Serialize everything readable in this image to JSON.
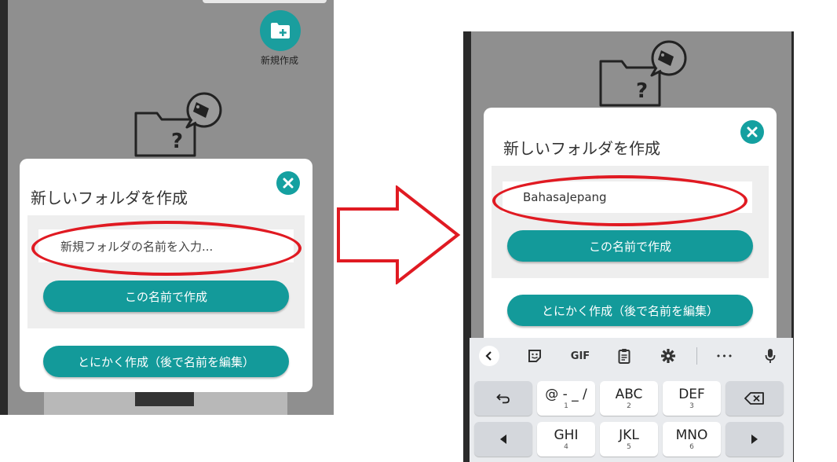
{
  "left": {
    "fab_label": "新規作成",
    "dialog": {
      "title": "新しいフォルダを作成",
      "input_placeholder": "新規フォルダの名前を入力...",
      "create_with_name": "この名前で作成",
      "create_anyway": "とにかく作成（後で名前を編集）"
    }
  },
  "right": {
    "dialog": {
      "title": "新しいフォルダを作成",
      "input_value": "BahasaJepang",
      "create_with_name": "この名前で作成",
      "create_anyway": "とにかく作成（後で名前を編集）"
    },
    "keyboard": {
      "toolbar": {
        "gif": "GIF",
        "more": "•••"
      },
      "keys": [
        {
          "main": "@ - _ /",
          "sub": "1"
        },
        {
          "main": "ABC",
          "sub": "2"
        },
        {
          "main": "DEF",
          "sub": "3"
        },
        {
          "main": "GHI",
          "sub": "4"
        },
        {
          "main": "JKL",
          "sub": "5"
        },
        {
          "main": "MNO",
          "sub": "6"
        }
      ]
    }
  },
  "colors": {
    "teal": "#139a9a",
    "highlight_red": "#e01a22",
    "overlay_gray": "#8f8f8f"
  }
}
